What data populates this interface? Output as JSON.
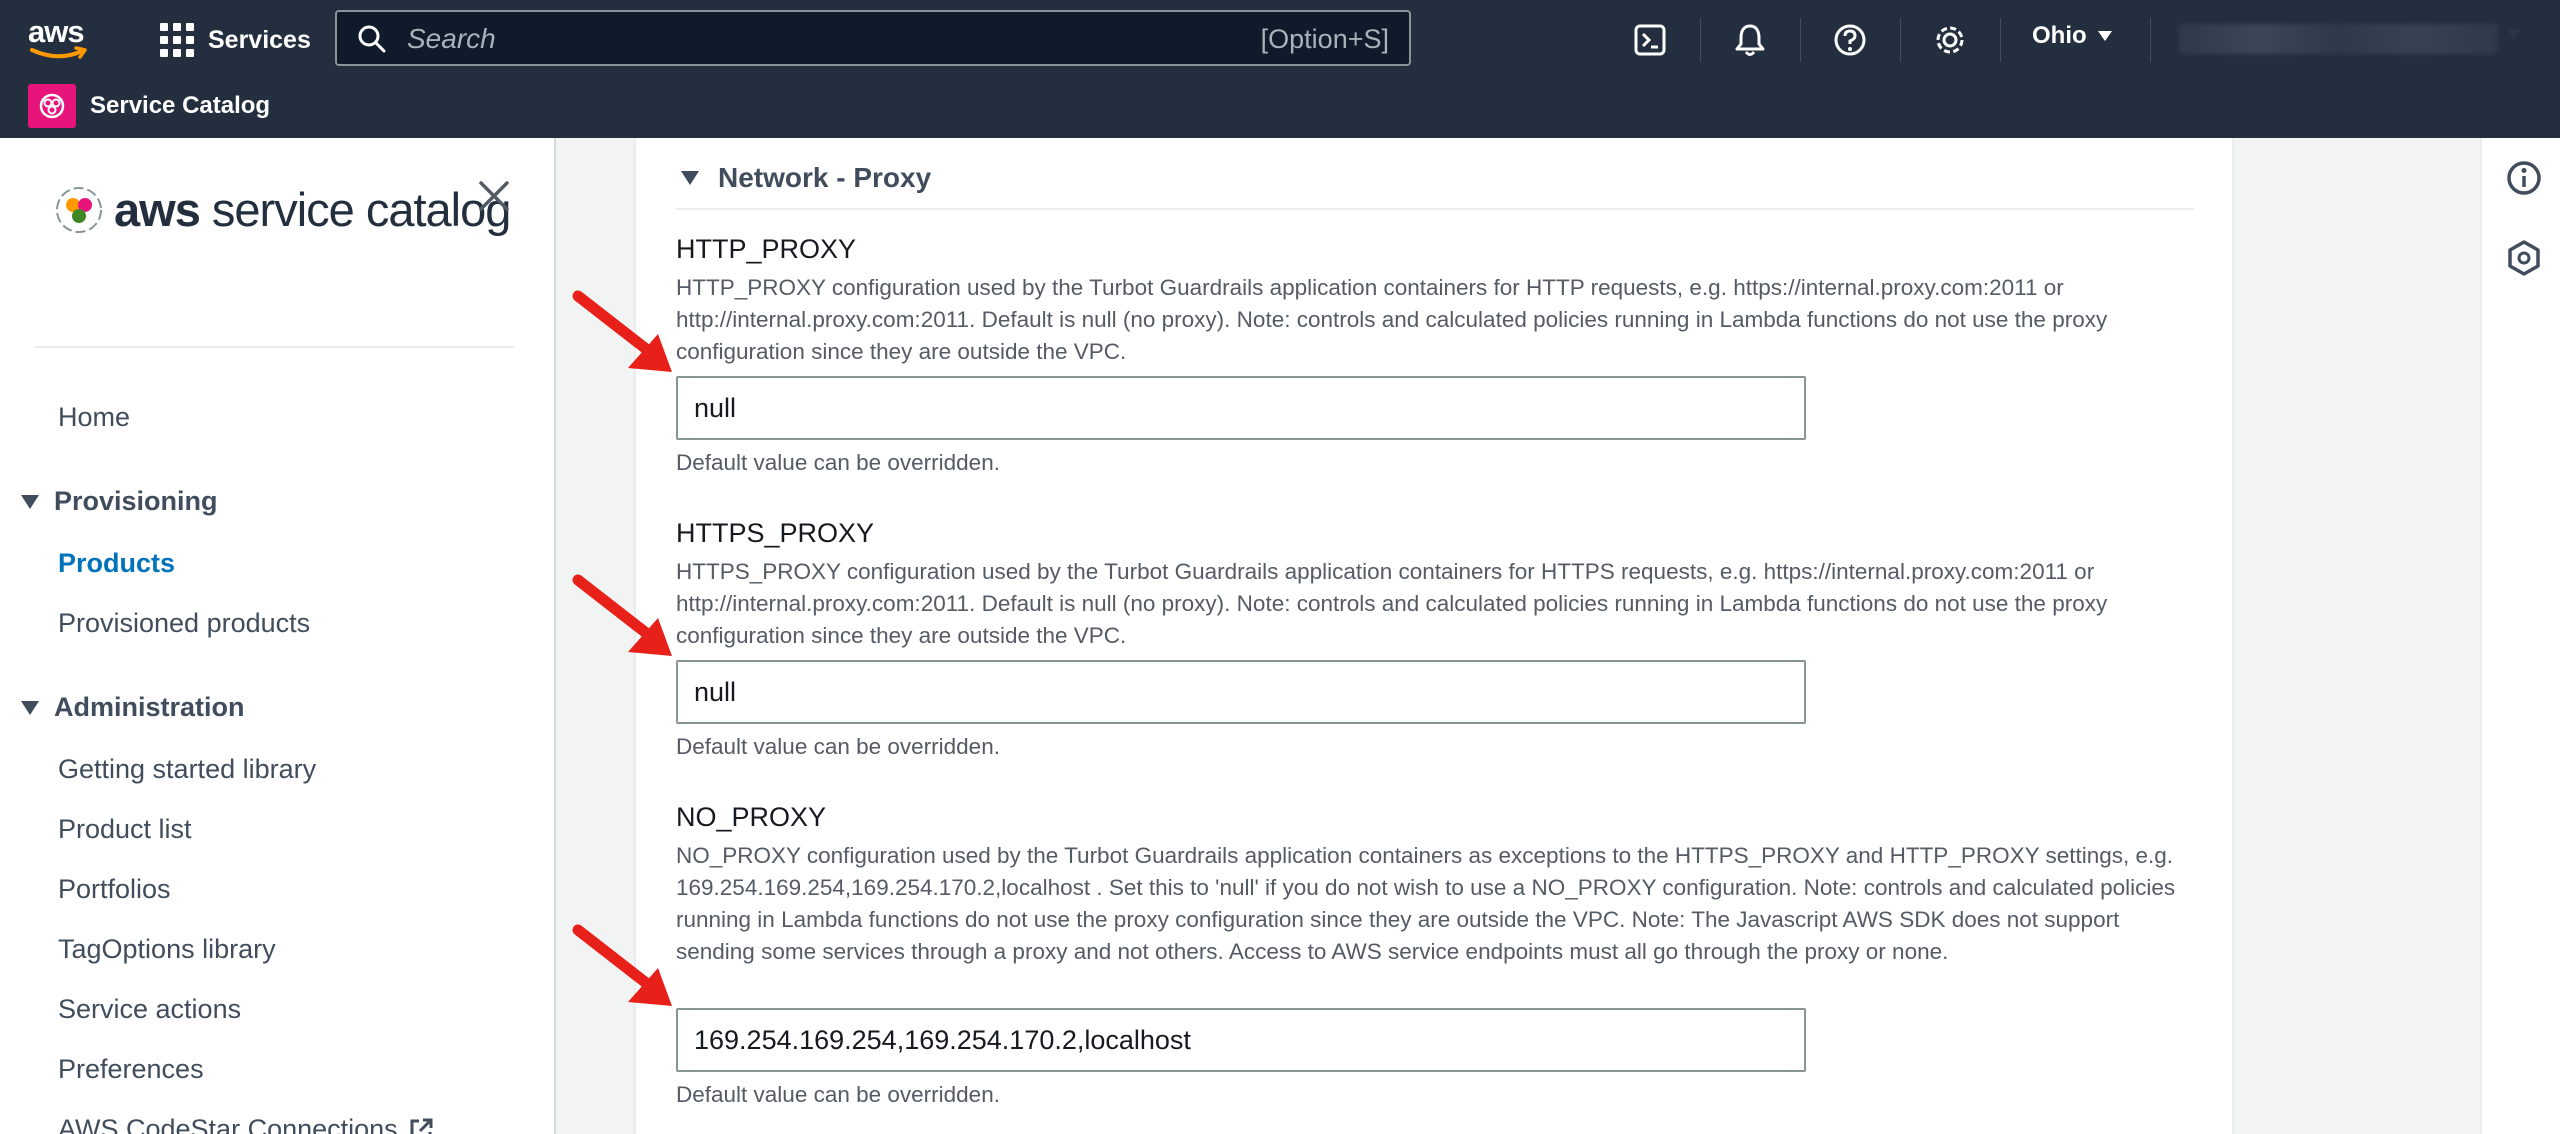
{
  "topnav": {
    "logo_text": "aws",
    "services_label": "Services",
    "search_placeholder": "Search",
    "search_shortcut": "[Option+S]",
    "icons": [
      "cloudshell-icon",
      "bell-icon",
      "help-icon",
      "gear-icon"
    ],
    "region": "Ohio",
    "service_name": "Service Catalog"
  },
  "sidebar": {
    "logo_bold": "aws",
    "logo_rest": " service catalog",
    "home": "Home",
    "provisioning": {
      "title": "Provisioning",
      "items": [
        "Products",
        "Provisioned products"
      ],
      "active": "Products"
    },
    "administration": {
      "title": "Administration",
      "items": [
        "Getting started library",
        "Product list",
        "Portfolios",
        "TagOptions library",
        "Service actions",
        "Preferences",
        "AWS CodeStar Connections"
      ]
    }
  },
  "main": {
    "section_title": "Network - Proxy",
    "fields": [
      {
        "label": "HTTP_PROXY",
        "description": "HTTP_PROXY configuration used by the Turbot Guardrails application containers for HTTP requests, e.g. https://internal.proxy.com:2011 or http://internal.proxy.com:2011. Default is null (no proxy). Note: controls and calculated policies running in Lambda functions do not use the proxy configuration since they are outside the VPC.",
        "value": "null",
        "hint": "Default value can be overridden."
      },
      {
        "label": "HTTPS_PROXY",
        "description": "HTTPS_PROXY configuration used by the Turbot Guardrails application containers for HTTPS requests, e.g. https://internal.proxy.com:2011 or http://internal.proxy.com:2011. Default is null (no proxy). Note: controls and calculated policies running in Lambda functions do not use the proxy configuration since they are outside the VPC.",
        "value": "null",
        "hint": "Default value can be overridden."
      },
      {
        "label": "NO_PROXY",
        "description": "NO_PROXY configuration used by the Turbot Guardrails application containers as exceptions to the HTTPS_PROXY and HTTP_PROXY settings, e.g. 169.254.169.254,169.254.170.2,localhost . Set this to 'null' if you do not wish to use a NO_PROXY configuration. Note: controls and calculated policies running in Lambda functions do not use the proxy configuration since they are outside the VPC. Note: The Javascript AWS SDK does not support sending some services through a proxy and not others. Access to AWS service endpoints must all go through the proxy or none.",
        "value": "169.254.169.254,169.254.170.2,localhost",
        "hint": "Default value can be overridden."
      }
    ]
  },
  "right_rail": {
    "icons": [
      "info-icon",
      "feedback-icon"
    ]
  },
  "colors": {
    "nav_bg": "#232f3e",
    "active_link": "#0073bb",
    "service_icon": "#e7157b",
    "annotation_arrow": "#e8201a"
  }
}
